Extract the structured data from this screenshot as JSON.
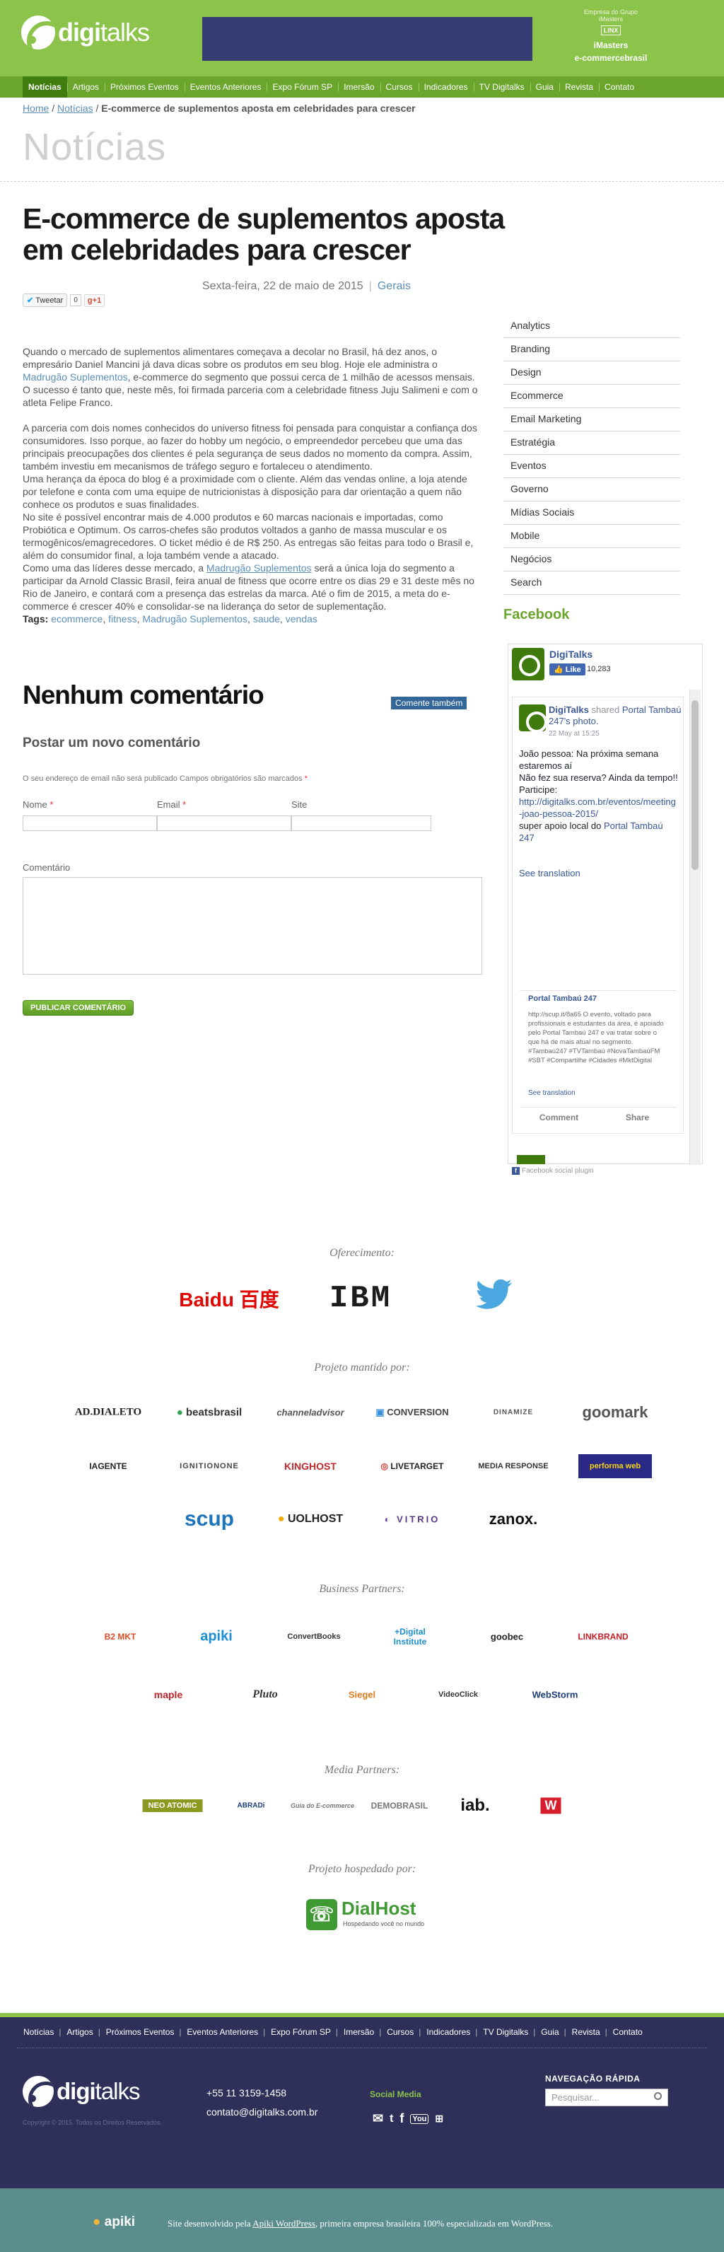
{
  "site": {
    "logo": "digitalks",
    "group_caption": "Empresa do Grupo iMasters",
    "group_brands": [
      "LINX",
      "iMasters",
      "e-commercebrasil"
    ]
  },
  "nav": [
    "Notícias",
    "Artigos",
    "Próximos Eventos",
    "Eventos Anteriores",
    "Expo Fórum SP",
    "Imersão",
    "Cursos",
    "Indicadores",
    "TV Digitalks",
    "Guia",
    "Revista",
    "Contato"
  ],
  "breadcrumb": {
    "home": "Home",
    "section": "Notícias",
    "separator": "/",
    "current": "E-commerce de suplementos aposta em celebridades para crescer"
  },
  "section_title": "Notícias",
  "article": {
    "title": "E-commerce de suplementos aposta em celebridades para crescer",
    "date": "Sexta-feira, 22 de maio de 2015",
    "category": "Gerais",
    "tweet_label": "Tweetar",
    "tweet_count": "0",
    "gplus_label": "g+1",
    "paragraphs": [
      {
        "pre": "Quando o mercado de suplementos alimentares começava a decolar no Brasil, há dez anos, o empresário Daniel Mancini já dava dicas sobre os produtos em seu blog. Hoje ele administra o ",
        "link": "Madrugão Suplementos",
        "post": ", e-commerce do segmento que possui cerca de 1 milhão de acessos mensais. O sucesso é tanto que, neste mês, foi firmada parceria com a celebridade fitness Juju Salimeni e com o atleta Felipe Franco."
      },
      {
        "pre": "A parceria com dois nomes conhecidos do universo fitness foi pensada para conquistar a confiança dos consumidores. Isso porque, ao fazer do hobby um negócio, o empreendedor percebeu que uma das principais preocupações dos clientes é pela segurança de seus dados no momento da compra. Assim, também investiu em mecanismos de tráfego seguro e fortaleceu o atendimento.",
        "link": "",
        "post": ""
      },
      {
        "pre": "Uma herança da época do blog é a proximidade com o cliente. Além das vendas online, a loja atende por telefone e conta com uma equipe de nutricionistas à disposição para dar orientação a quem não conhece os produtos e suas finalidades.",
        "link": "",
        "post": ""
      },
      {
        "pre": "No site é possível encontrar mais de 4.000 produtos e 60 marcas nacionais e importadas, como Probiótica e Optimum. Os carros-chefes são produtos voltados a ganho de massa muscular e os termogênicos/emagrecedores. O ticket médio é de R$ 250. As entregas são feitas para todo o Brasil e, além do consumidor final, a loja também vende a atacado.",
        "link": "",
        "post": ""
      },
      {
        "pre": "Como uma das líderes desse mercado, a ",
        "link": "Madrugão Suplementos",
        "post": " será a única loja do segmento a participar da Arnold Classic Brasil, feira anual de fitness que ocorre entre os dias 29 e 31 deste mês no Rio de Janeiro, e contará com a presença das estrelas da marca. Até o fim de 2015, a meta do e-commerce é crescer 40% e consolidar-se na liderança do setor de suplementação."
      }
    ],
    "tags_label": "Tags:",
    "tags": [
      "ecommerce",
      "fitness",
      "Madrugão Suplementos",
      "saude",
      "vendas"
    ]
  },
  "comments": {
    "heading": "Nenhum comentário",
    "comment_button": "Comente também",
    "post_heading": "Postar um novo comentário",
    "email_note": "O seu endereço de email não será publicado Campos obrigatórios são marcados",
    "required_mark": "*",
    "fields": {
      "name": "Nome",
      "email": "Email",
      "site": "Site",
      "comment": "Comentário"
    },
    "publish": "PUBLICAR COMENTÁRIO"
  },
  "sidebar": {
    "categories": [
      "Analytics",
      "Branding",
      "Design",
      "Ecommerce",
      "Email Marketing",
      "Estratégia",
      "Eventos",
      "Governo",
      "Mídias Sociais",
      "Mobile",
      "Negócios",
      "Search"
    ],
    "facebook_title": "Facebook",
    "fb": {
      "page_name": "DigiTalks",
      "like_label": "Like",
      "likes": "10,283",
      "card_author": "DigiTalks",
      "card_action": "shared",
      "card_ref": "Portal Tambaú 247's photo.",
      "card_time": "22 May at 15:25",
      "post_lines": [
        "João pessoa: Na próxima semana estaremos aí",
        "Não fez sua reserva? Ainda da tempo!!",
        "Participe:"
      ],
      "post_link": "http://digitalks.com.br/eventos/meeting-joao-pessoa-2015/",
      "post_support": "super apoio local do ",
      "post_support_link": "Portal Tambaú 247",
      "see_translation": "See translation",
      "inner_title": "Portal Tambaú 247",
      "inner_text": "http://scup.it/8a65 O evento, voltado para profissionais e estudantes da área, é apoiado pelo Portal Tambaú 247 e vai tratar sobre o que há de mais atual no segmento. #Tambaú247 #TVTambaú #NovaTambaúFM #SBT #Compartilhe #Cidades #MktDigital",
      "inner_translation": "See translation",
      "comment": "Comment",
      "share": "Share",
      "plugin_label": "Facebook social plugin"
    }
  },
  "sponsors": {
    "oferecimento_title": "Oferecimento:",
    "oferecimento": [
      "Baidu 百度",
      "IBM",
      "twitter"
    ],
    "projeto_title": "Projeto mantido por:",
    "projeto": [
      "AD.DIALETO",
      "beatsbrasil",
      "channeladvisor",
      "CONVERSION",
      "DINAMIZE",
      "goomark",
      "IAGENTE",
      "IGNITIONONE",
      "KINGHOST",
      "LIVETARGET",
      "MEDIA RESPONSE",
      "performa web",
      "scup",
      "UOLHOST",
      "VITRIO",
      "zanox."
    ],
    "business_title": "Business Partners:",
    "business": [
      "B2 MKT",
      "apiki",
      "ConvertBooks",
      "+Digital Institute",
      "goobec",
      "LINKBRAND",
      "maple",
      "Pluto",
      "Siegel",
      "VideoClick",
      "WebStorm"
    ],
    "media_title": "Media Partners:",
    "media": [
      "NEO ATOMIC",
      "ABRADi",
      "Guia do E-commerce",
      "DEMOBRASIL",
      "iab.",
      "W"
    ],
    "hosted_title": "Projeto hospedado por:",
    "hosted": [
      "DialHost",
      "Hospedando você no mundo"
    ]
  },
  "footer": {
    "nav": [
      "Notícias",
      "Artigos",
      "Próximos Eventos",
      "Eventos Anteriores",
      "Expo Fórum SP",
      "Imersão",
      "Cursos",
      "Indicadores",
      "TV Digitalks",
      "Guia",
      "Revista",
      "Contato"
    ],
    "logo": "digitalks",
    "copyright": "Copyright © 2015. Todos os Direitos Reservados.",
    "phone": "+55 11 3159-1458",
    "email": "contato@digitalks.com.br",
    "social_title": "Social Media",
    "quick_nav_title": "NAVEGAÇÃO RÁPIDA",
    "search_placeholder": "Pesquisar...",
    "apiki": "apiki",
    "credits_pre": "Site desenvolvido pela ",
    "credits_link": "Apiki WordPress",
    "credits_post": ", primeira empresa brasileira 100% especializada em WordPress."
  }
}
